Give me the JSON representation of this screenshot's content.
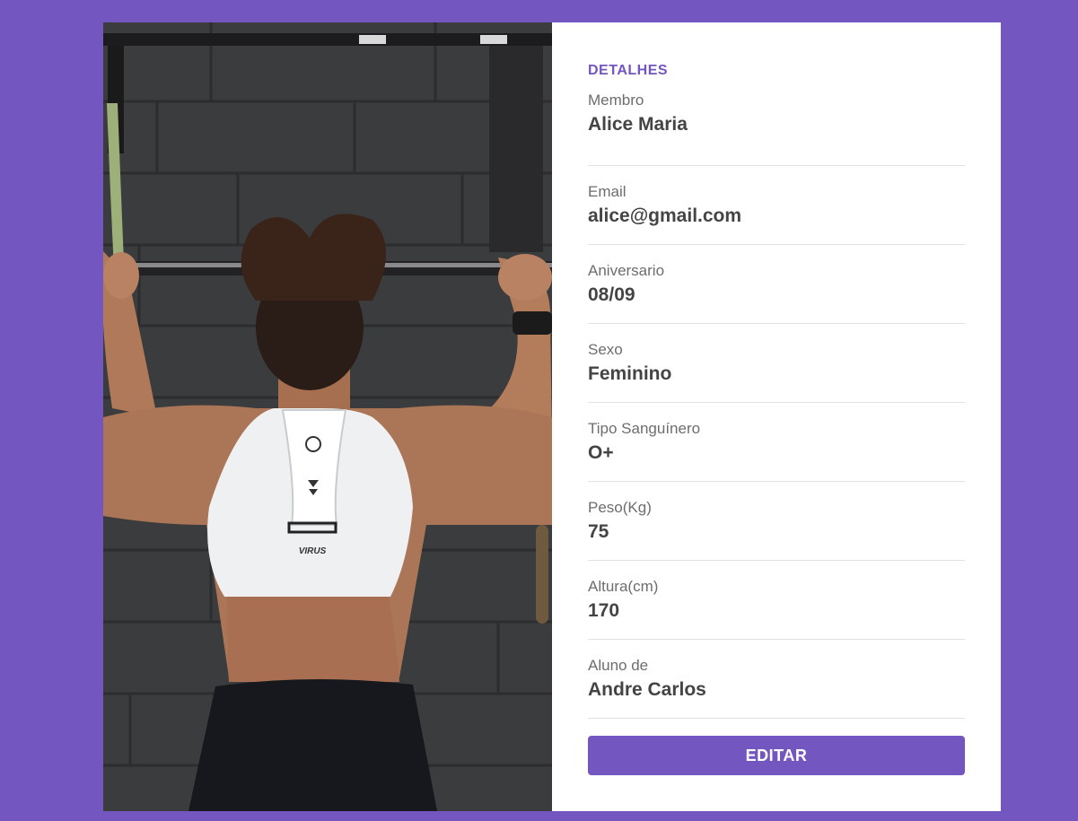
{
  "details": {
    "title": "DETALHES",
    "fields": [
      {
        "label": "Membro",
        "value": "Alice Maria"
      },
      {
        "label": "Email",
        "value": "alice@gmail.com"
      },
      {
        "label": "Aniversario",
        "value": "08/09"
      },
      {
        "label": "Sexo",
        "value": "Feminino"
      },
      {
        "label": "Tipo Sanguínero",
        "value": "O+"
      },
      {
        "label": "Peso(Kg)",
        "value": "75"
      },
      {
        "label": "Altura(cm)",
        "value": "170"
      },
      {
        "label": "Aluno de",
        "value": "Andre Carlos"
      }
    ],
    "edit_label": "EDITAR"
  },
  "photo": {
    "shirt_logo": "VIRUS"
  },
  "colors": {
    "accent": "#7456c0",
    "background": "#7456c0",
    "card": "#ffffff"
  }
}
